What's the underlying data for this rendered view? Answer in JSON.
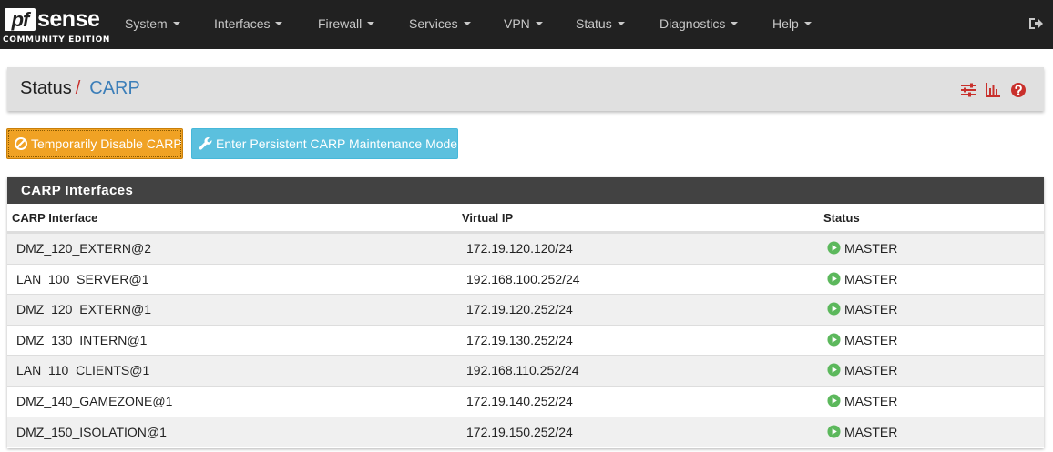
{
  "brand": {
    "pf": "pf",
    "sense": "sense",
    "edition": "COMMUNITY EDITION"
  },
  "nav": {
    "items": [
      "System",
      "Interfaces",
      "Firewall",
      "Services",
      "VPN",
      "Status",
      "Diagnostics",
      "Help"
    ],
    "logout_icon": "sign-out-icon"
  },
  "breadcrumb": {
    "parent": "Status",
    "separator": "/",
    "current": "CARP",
    "icons": [
      "sliders-icon",
      "bar-chart-icon",
      "question-circle-icon"
    ]
  },
  "actions": {
    "disable_label": "Temporarily Disable CARP",
    "maintenance_label": "Enter Persistent CARP Maintenance Mode"
  },
  "table": {
    "title": "CARP Interfaces",
    "columns": [
      "CARP Interface",
      "Virtual IP",
      "Status"
    ],
    "rows": [
      {
        "iface": "DMZ_120_EXTERN@2",
        "vip": "172.19.120.120/24",
        "status": "MASTER"
      },
      {
        "iface": "LAN_100_SERVER@1",
        "vip": "192.168.100.252/24",
        "status": "MASTER"
      },
      {
        "iface": "DMZ_120_EXTERN@1",
        "vip": "172.19.120.252/24",
        "status": "MASTER"
      },
      {
        "iface": "DMZ_130_INTERN@1",
        "vip": "172.19.130.252/24",
        "status": "MASTER"
      },
      {
        "iface": "LAN_110_CLIENTS@1",
        "vip": "192.168.110.252/24",
        "status": "MASTER"
      },
      {
        "iface": "DMZ_140_GAMEZONE@1",
        "vip": "172.19.140.252/24",
        "status": "MASTER"
      },
      {
        "iface": "DMZ_150_ISOLATION@1",
        "vip": "172.19.150.252/24",
        "status": "MASTER"
      }
    ]
  },
  "colors": {
    "navbar": "#212121",
    "accent_red": "#c9302c",
    "link_blue": "#3d7fb9",
    "warning": "#f0a224",
    "info": "#5bc0de",
    "status_green": "#5cb85c"
  }
}
